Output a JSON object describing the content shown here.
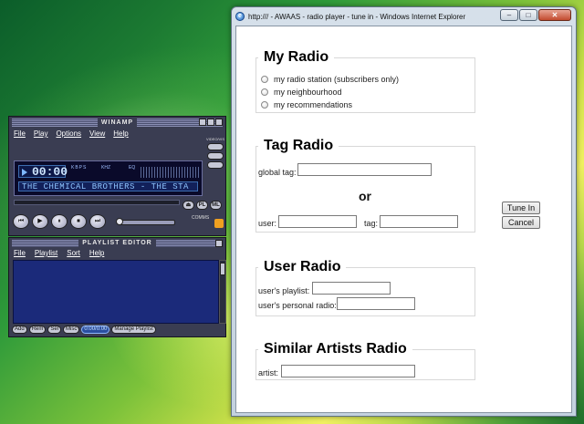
{
  "winamp": {
    "title": "WINAMP",
    "menu": [
      "File",
      "Play",
      "Options",
      "View",
      "Help"
    ],
    "time": "00:00",
    "kbps_label": "KBPS",
    "khz_label": "KHZ",
    "eq_label": "EQ",
    "marquee": "THE CHEMICAL BROTHERS - THE STA",
    "side_label": "VIDEO/VIS",
    "small_buttons": [
      "⏏",
      "PL",
      "ML"
    ],
    "controls": [
      "⏮",
      "▶",
      "⏸",
      "⏹",
      "⏭"
    ],
    "comm_label": "COMMS"
  },
  "playlist": {
    "title": "PLAYLIST EDITOR",
    "menu": [
      "File",
      "Playlist",
      "Sort",
      "Help"
    ],
    "buttons": [
      "Add",
      "Rem",
      "Sel",
      "Misc"
    ],
    "time_display": "0:00/0:00",
    "manage_label": "Manage Playlist"
  },
  "ie": {
    "title": "http:/// - AWAAS - radio player - tune in - Windows Internet Explorer",
    "icon_letter": "e",
    "min_glyph": "–",
    "max_glyph": "□",
    "close_glyph": "✕"
  },
  "my_radio": {
    "heading": "My Radio",
    "options": [
      "my radio station (subscribers only)",
      "my neighbourhood",
      "my recommendations"
    ]
  },
  "tag_radio": {
    "heading": "Tag Radio",
    "global_tag_label": "global tag:",
    "or_text": "or",
    "user_label": "user:",
    "tag_label": "tag:",
    "global_tag_value": "",
    "user_value": "",
    "tag_value": ""
  },
  "user_radio": {
    "heading": "User Radio",
    "playlist_label": "user's playlist:",
    "personal_label": "user's personal radio:",
    "playlist_value": "",
    "personal_value": ""
  },
  "similar_radio": {
    "heading": "Similar Artists Radio",
    "artist_label": "artist:",
    "artist_value": ""
  },
  "actions": {
    "tune_in": "Tune In",
    "cancel": "Cancel"
  }
}
